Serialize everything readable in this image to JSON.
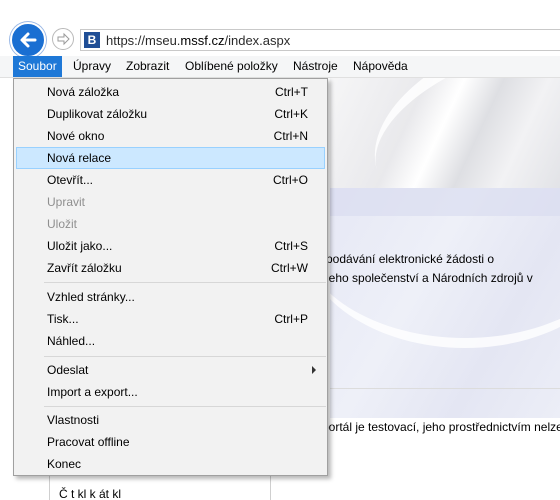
{
  "browser": {
    "url_prefix": "https://mseu.",
    "url_domain": "mssf.cz",
    "url_path": "/index.aspx",
    "favicon_letter": "B"
  },
  "menubar": {
    "items": [
      "Soubor",
      "Úpravy",
      "Zobrazit",
      "Oblíbené položky",
      "Nástroje",
      "Nápověda"
    ]
  },
  "file_menu": {
    "items": [
      {
        "label": "Nová záložka",
        "shortcut": "Ctrl+T"
      },
      {
        "label": "Duplikovat záložku",
        "shortcut": "Ctrl+K"
      },
      {
        "label": "Nové okno",
        "shortcut": "Ctrl+N"
      },
      {
        "label": "Nová relace",
        "shortcut": ""
      },
      {
        "label": "Otevřít...",
        "shortcut": "Ctrl+O"
      },
      {
        "label": "Upravit",
        "shortcut": ""
      },
      {
        "label": "Uložit",
        "shortcut": ""
      },
      {
        "label": "Uložit jako...",
        "shortcut": "Ctrl+S"
      },
      {
        "label": "Zavřít záložku",
        "shortcut": "Ctrl+W"
      },
      {
        "label": "Vzhled stránky...",
        "shortcut": ""
      },
      {
        "label": "Tisk...",
        "shortcut": "Ctrl+P"
      },
      {
        "label": "Náhled...",
        "shortcut": ""
      },
      {
        "label": "Odeslat",
        "shortcut": ""
      },
      {
        "label": "Import a export...",
        "shortcut": ""
      },
      {
        "label": "Vlastnosti",
        "shortcut": ""
      },
      {
        "label": "Pracovat offline",
        "shortcut": ""
      },
      {
        "label": "Konec",
        "shortcut": ""
      }
    ]
  },
  "page": {
    "intro_line1": "podávání elektronické žádosti o",
    "intro_line2": "jeho společenství a Národních zdrojů v",
    "warning": "portál je testovací, jeho prostřednictvím nelze",
    "left_box_text": "Č     t  kl     k    át  kl"
  },
  "colors": {
    "menu_active": "#1e78d7",
    "hover_item": "#cce8ff",
    "back_button": "#1a6fd2"
  }
}
